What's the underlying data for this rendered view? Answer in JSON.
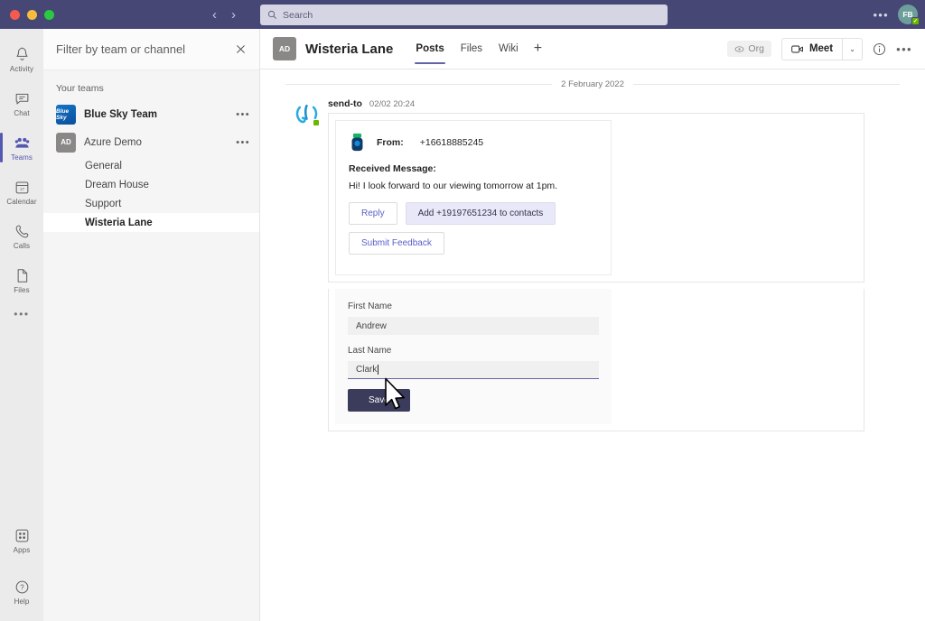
{
  "titlebar": {
    "nav_back": "‹",
    "nav_forward": "›",
    "search_placeholder": "Search",
    "more_label": "•••",
    "avatar_initials": "FB"
  },
  "rail": {
    "items": [
      {
        "label": "Activity",
        "icon": "bell-icon"
      },
      {
        "label": "Chat",
        "icon": "chat-icon"
      },
      {
        "label": "Teams",
        "icon": "teams-icon"
      },
      {
        "label": "Calendar",
        "icon": "calendar-icon"
      },
      {
        "label": "Calls",
        "icon": "phone-icon"
      },
      {
        "label": "Files",
        "icon": "files-icon"
      }
    ],
    "more_label": "•••",
    "bottom": [
      {
        "label": "Apps",
        "icon": "apps-icon"
      },
      {
        "label": "Help",
        "icon": "help-icon"
      }
    ],
    "active_index": 2
  },
  "teams_panel": {
    "filter_placeholder": "Filter by team or channel",
    "filter_value": "",
    "close_label": "✕",
    "section_title": "Your teams",
    "teams": [
      {
        "name": "Blue Sky Team",
        "avatar_text": "Blue Sky",
        "avatar_kind": "bluesky",
        "more_label": "•••",
        "channels": []
      },
      {
        "name": "Azure Demo",
        "avatar_text": "AD",
        "avatar_kind": "ad",
        "more_label": "•••",
        "channels": [
          {
            "name": "General",
            "selected": false
          },
          {
            "name": "Dream House",
            "selected": false
          },
          {
            "name": "Support",
            "selected": false
          },
          {
            "name": "Wisteria Lane",
            "selected": true
          }
        ]
      }
    ]
  },
  "channel_header": {
    "avatar_text": "AD",
    "title": "Wisteria Lane",
    "tabs": [
      {
        "label": "Posts",
        "active": true
      },
      {
        "label": "Files",
        "active": false
      },
      {
        "label": "Wiki",
        "active": false
      }
    ],
    "add_tab_label": "+",
    "org_label": "Org",
    "meet_label": "Meet",
    "meet_caret": "⌄",
    "info_label": "i",
    "more_label": "•••"
  },
  "conversation": {
    "date_divider": "2 February 2022",
    "message": {
      "sender": "send-to",
      "timestamp": "02/02 20:24",
      "card": {
        "from_label": "From:",
        "from_number": "+16618885245",
        "received_label": "Received Message:",
        "received_text": "Hi! I look forward to our viewing tomorrow at 1pm.",
        "buttons": [
          {
            "label": "Reply",
            "style": "outline"
          },
          {
            "label": "Add  +19197651234  to contacts",
            "style": "filled"
          },
          {
            "label": "Submit Feedback",
            "style": "outline"
          }
        ]
      },
      "form": {
        "first_name_label": "First Name",
        "first_name_value": "Andrew",
        "last_name_label": "Last Name",
        "last_name_value": "Clark",
        "save_label": "Save"
      }
    }
  },
  "colors": {
    "titlebar": "#464775",
    "accent": "#6264a7",
    "link": "#5b5fc7",
    "save_button": "#3b3b5c",
    "presence_green": "#6bb700"
  }
}
